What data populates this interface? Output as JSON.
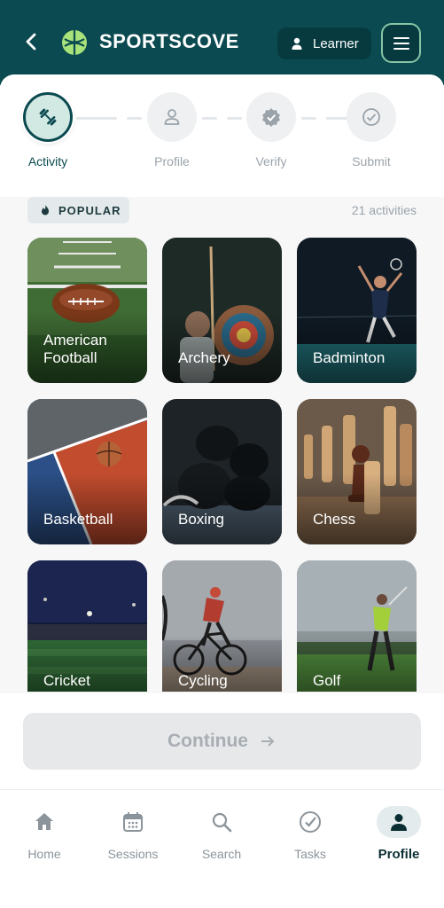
{
  "header": {
    "brand": "SPORTSCOVE",
    "role_label": "Learner",
    "back_icon": "back-arrow-icon",
    "logo_icon": "sportscove-logo-icon",
    "menu_icon": "hamburger-menu-icon"
  },
  "stepper": {
    "steps": [
      {
        "label": "Activity",
        "icon": "dumbbell-icon",
        "state": "active"
      },
      {
        "label": "Profile",
        "icon": "user-icon",
        "state": "pending"
      },
      {
        "label": "Verify",
        "icon": "verified-badge-icon",
        "state": "pending"
      },
      {
        "label": "Submit",
        "icon": "check-circle-icon",
        "state": "pending"
      }
    ]
  },
  "content": {
    "badge": "POPULAR",
    "count": "21 activities",
    "activities": [
      {
        "name": "American Football"
      },
      {
        "name": "Archery"
      },
      {
        "name": "Badminton"
      },
      {
        "name": "Basketball"
      },
      {
        "name": "Boxing"
      },
      {
        "name": "Chess"
      },
      {
        "name": "Cricket"
      },
      {
        "name": "Cycling"
      },
      {
        "name": "Golf"
      }
    ]
  },
  "continue": {
    "label": "Continue",
    "enabled": false
  },
  "tabs": [
    {
      "label": "Home",
      "icon": "home-icon",
      "active": false
    },
    {
      "label": "Sessions",
      "icon": "calendar-icon",
      "active": false
    },
    {
      "label": "Search",
      "icon": "search-icon",
      "active": false
    },
    {
      "label": "Tasks",
      "icon": "check-circle-icon",
      "active": false
    },
    {
      "label": "Profile",
      "icon": "user-icon",
      "active": true
    }
  ],
  "colors": {
    "primary": "#0a4a50",
    "accent": "#86c5a6",
    "muted": "#9aa3aa"
  }
}
